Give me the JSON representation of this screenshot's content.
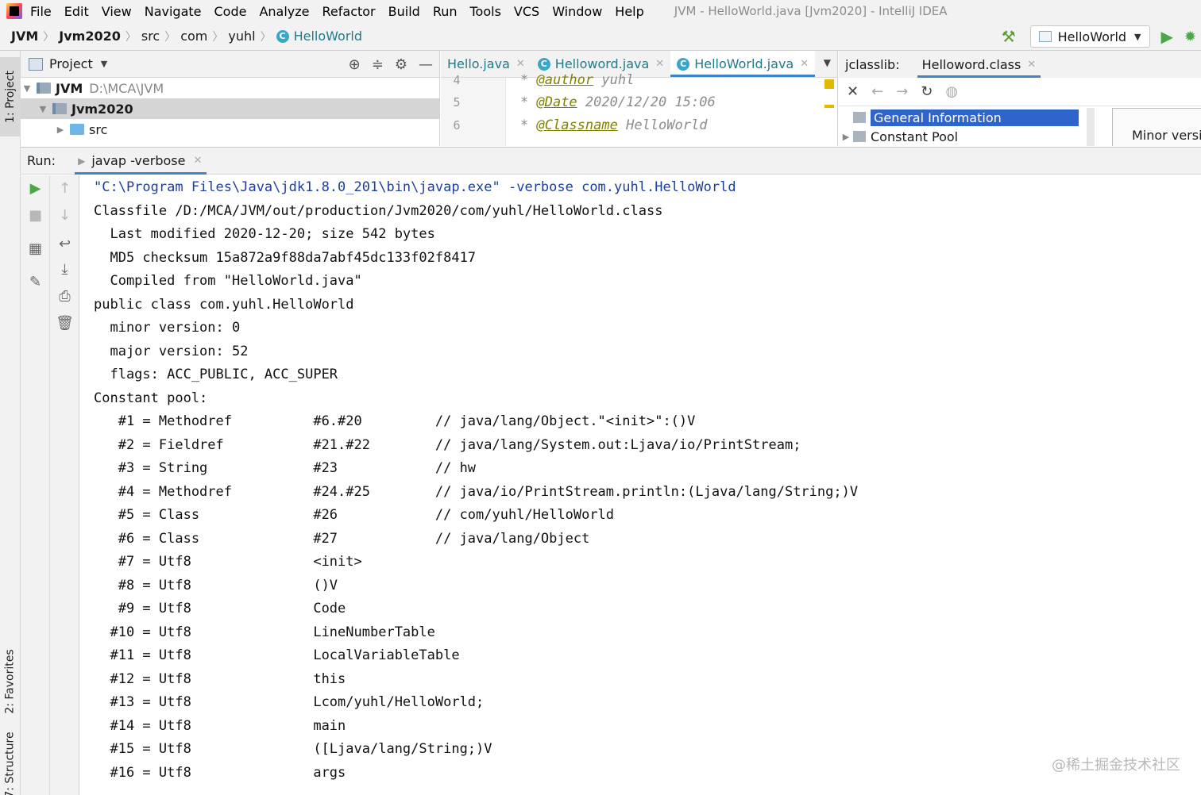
{
  "menubar": {
    "items": [
      "File",
      "Edit",
      "View",
      "Navigate",
      "Code",
      "Analyze",
      "Refactor",
      "Build",
      "Run",
      "Tools",
      "VCS",
      "Window",
      "Help"
    ],
    "window_title": "JVM - HelloWorld.java [Jvm2020] - IntelliJ IDEA"
  },
  "navbar": {
    "crumbs": [
      "JVM",
      "Jvm2020",
      "src",
      "com",
      "yuhl",
      "HelloWorld"
    ],
    "run_config": "HelloWorld"
  },
  "left_stripe": {
    "project": "1: Project",
    "favorites": "2: Favorites",
    "structure": "7: Structure"
  },
  "project_panel": {
    "title": "Project",
    "tree": [
      {
        "name": "JVM",
        "path": "D:\\MCA\\JVM"
      },
      {
        "name": "Jvm2020",
        "path": ""
      },
      {
        "name": "src",
        "path": ""
      }
    ]
  },
  "editor": {
    "tabs": [
      "Hello.java",
      "Helloword.java",
      "HelloWorld.java"
    ],
    "active_tab": "HelloWorld.java",
    "lines": [
      {
        "num": "4",
        "tag": "@author",
        "value": "yuhl"
      },
      {
        "num": "5",
        "tag": "@Date",
        "value": "2020/12/20 15:06"
      },
      {
        "num": "6",
        "tag": "@Classname",
        "value": "HelloWorld"
      }
    ]
  },
  "jclasslib": {
    "label": "jclasslib:",
    "tab": "Helloword.class",
    "tree": [
      "General Information",
      "Constant Pool"
    ],
    "detail_label": "Minor version"
  },
  "run": {
    "label": "Run:",
    "tab": "javap -verbose"
  },
  "console": {
    "lines": [
      "\"C:\\Program Files\\Java\\jdk1.8.0_201\\bin\\javap.exe\" -verbose com.yuhl.HelloWorld",
      "Classfile /D:/MCA/JVM/out/production/Jvm2020/com/yuhl/HelloWorld.class",
      "  Last modified 2020-12-20; size 542 bytes",
      "  MD5 checksum 15a872a9f88da7abf45dc133f02f8417",
      "  Compiled from \"HelloWorld.java\"",
      "public class com.yuhl.HelloWorld",
      "  minor version: 0",
      "  major version: 52",
      "  flags: ACC_PUBLIC, ACC_SUPER",
      "Constant pool:",
      "   #1 = Methodref          #6.#20         // java/lang/Object.\"<init>\":()V",
      "   #2 = Fieldref           #21.#22        // java/lang/System.out:Ljava/io/PrintStream;",
      "   #3 = String             #23            // hw",
      "   #4 = Methodref          #24.#25        // java/io/PrintStream.println:(Ljava/lang/String;)V",
      "   #5 = Class              #26            // com/yuhl/HelloWorld",
      "   #6 = Class              #27            // java/lang/Object",
      "   #7 = Utf8               <init>",
      "   #8 = Utf8               ()V",
      "   #9 = Utf8               Code",
      "  #10 = Utf8               LineNumberTable",
      "  #11 = Utf8               LocalVariableTable",
      "  #12 = Utf8               this",
      "  #13 = Utf8               Lcom/yuhl/HelloWorld;",
      "  #14 = Utf8               main",
      "  #15 = Utf8               ([Ljava/lang/String;)V",
      "  #16 = Utf8               args"
    ]
  },
  "watermark": "@稀土掘金技术社区"
}
